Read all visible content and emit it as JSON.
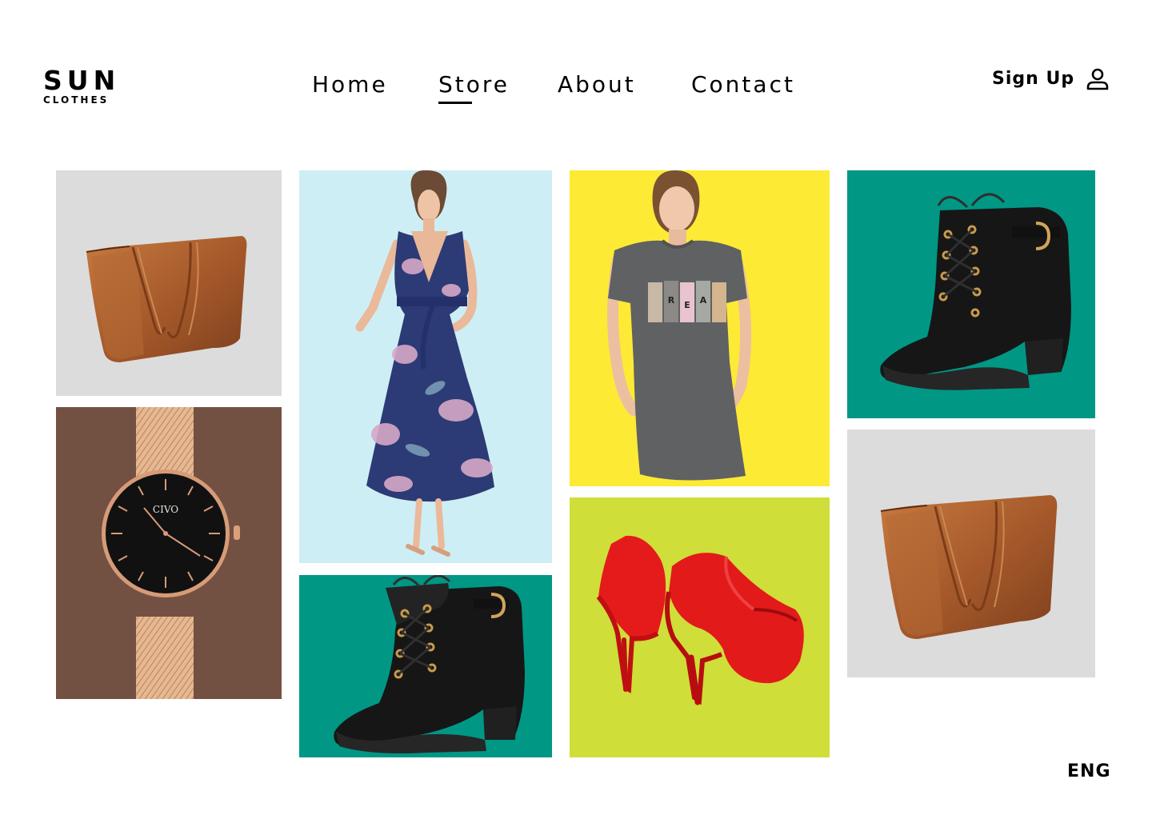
{
  "brand": {
    "name": "SUN",
    "tagline": "CLOTHES"
  },
  "nav": {
    "items": [
      {
        "label": "Home",
        "active": false
      },
      {
        "label": "Store",
        "active": true
      },
      {
        "label": "About",
        "active": false
      },
      {
        "label": "Contact",
        "active": false
      }
    ]
  },
  "account": {
    "signup_label": "Sign Up",
    "icon": "user-icon"
  },
  "language": {
    "current": "ENG"
  },
  "gallery": {
    "products": [
      {
        "item": "leather tote bag",
        "background": "#dcdcdc"
      },
      {
        "item": "rose gold mesh watch",
        "background": "#735142",
        "watch_brand": "CIVO"
      },
      {
        "item": "floral wrap maxi dress",
        "background": "#ceeef5"
      },
      {
        "item": "black lace-up ankle boots",
        "background": "#009785"
      },
      {
        "item": "grey t-shirt dress",
        "background": "#fdea35"
      },
      {
        "item": "red suede high heels",
        "background": "#cfde38"
      },
      {
        "item": "black lace-up ankle boots",
        "background": "#009785"
      },
      {
        "item": "leather tote bag",
        "background": "#dcdcdc"
      }
    ]
  },
  "colors": {
    "text": "#000000",
    "page_background": "#ffffff"
  }
}
